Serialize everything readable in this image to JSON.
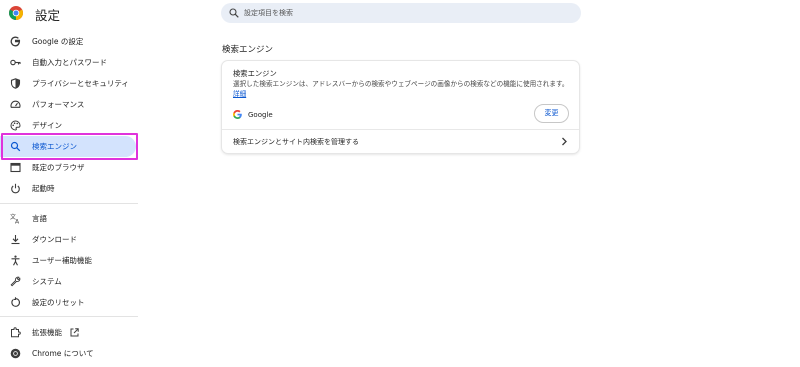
{
  "header": {
    "title": "設定",
    "logo_icon": "chrome-logo-icon"
  },
  "search": {
    "placeholder": "設定項目を検索",
    "icon": "search-icon"
  },
  "sidebar": {
    "items": [
      {
        "label": "Google の設定",
        "icon": "google-g-icon"
      },
      {
        "label": "自動入力とパスワード",
        "icon": "key-icon"
      },
      {
        "label": "プライバシーとセキュリティ",
        "icon": "shield-icon"
      },
      {
        "label": "パフォーマンス",
        "icon": "speedometer-icon"
      },
      {
        "label": "デザイン",
        "icon": "palette-icon"
      },
      {
        "label": "検索エンジン",
        "icon": "search-icon",
        "selected": true
      },
      {
        "label": "既定のブラウザ",
        "icon": "browser-window-icon"
      },
      {
        "label": "起動時",
        "icon": "power-icon"
      },
      {
        "label": "言語",
        "icon": "translate-icon"
      },
      {
        "label": "ダウンロード",
        "icon": "download-icon"
      },
      {
        "label": "ユーザー補助機能",
        "icon": "accessibility-icon"
      },
      {
        "label": "システム",
        "icon": "wrench-icon"
      },
      {
        "label": "設定のリセット",
        "icon": "reset-icon"
      },
      {
        "label": "拡張機能",
        "icon": "extension-icon",
        "trailing_icon": "open-in-new-icon"
      },
      {
        "label": "Chrome について",
        "icon": "chrome-logo-icon"
      }
    ],
    "accent_color": "#0b57d0",
    "selected_bg": "#d3e3fd",
    "highlight_color": "#e033dc"
  },
  "main": {
    "section_title": "検索エンジン",
    "card": {
      "title": "検索エンジン",
      "description": "選択した検索エンジンは、アドレスバーからの検索やウェブページの画像からの検索などの機能に使用されます。",
      "learn_more": "詳細",
      "engine_name": "Google",
      "change_label": "変更",
      "manage_label": "検索エンジンとサイト内検索を管理する"
    }
  }
}
